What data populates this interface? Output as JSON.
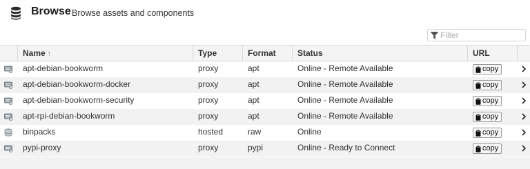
{
  "header": {
    "title": "Browse",
    "subtitle": "Browse assets and components",
    "icon": "database-icon"
  },
  "filter": {
    "placeholder": "Filter",
    "value": "",
    "icon": "funnel-icon"
  },
  "columns": {
    "name": "Name",
    "type": "Type",
    "format": "Format",
    "status": "Status",
    "url": "URL",
    "sort_indicator": "↑"
  },
  "copy_label": "copy",
  "rows": [
    {
      "name": "apt-debian-bookworm",
      "type": "proxy",
      "format": "apt",
      "status": "Online - Remote Available",
      "icon": "proxy-repository-icon"
    },
    {
      "name": "apt-debian-bookworm-docker",
      "type": "proxy",
      "format": "apt",
      "status": "Online - Remote Available",
      "icon": "proxy-repository-icon"
    },
    {
      "name": "apt-debian-bookworm-security",
      "type": "proxy",
      "format": "apt",
      "status": "Online - Remote Available",
      "icon": "proxy-repository-icon"
    },
    {
      "name": "apt-rpi-debian-bookworm",
      "type": "proxy",
      "format": "apt",
      "status": "Online - Remote Available",
      "icon": "proxy-repository-icon"
    },
    {
      "name": "binpacks",
      "type": "hosted",
      "format": "raw",
      "status": "Online",
      "icon": "hosted-repository-icon"
    },
    {
      "name": "pypi-proxy",
      "type": "proxy",
      "format": "pypi",
      "status": "Online - Ready to Connect",
      "icon": "proxy-repository-icon"
    }
  ]
}
